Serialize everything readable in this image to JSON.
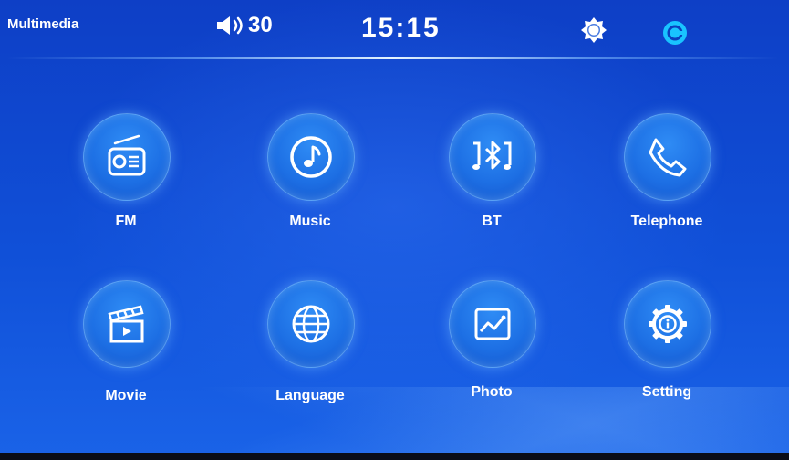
{
  "status_bar": {
    "app_title": "Multimedia",
    "volume_level": "30",
    "clock": "15:15",
    "volume_icon": "speaker-icon",
    "brightness_icon": "sun-icon",
    "theme_icon": "theme-icon"
  },
  "menu": {
    "items": [
      {
        "label": "FM",
        "icon": "radio-icon"
      },
      {
        "label": "Music",
        "icon": "music-note-icon"
      },
      {
        "label": "BT",
        "icon": "bluetooth-music-icon"
      },
      {
        "label": "Telephone",
        "icon": "phone-icon"
      },
      {
        "label": "Movie",
        "icon": "clapperboard-icon"
      },
      {
        "label": "Language",
        "icon": "globe-icon"
      },
      {
        "label": "Photo",
        "icon": "picture-icon"
      },
      {
        "label": "Setting",
        "icon": "gear-icon"
      }
    ]
  },
  "colors": {
    "background": "#1050d8",
    "tile": "#1d6fe4",
    "text": "#ffffff",
    "brightness_icon": "#ffffff",
    "theme_icon": "#19c3ff"
  }
}
